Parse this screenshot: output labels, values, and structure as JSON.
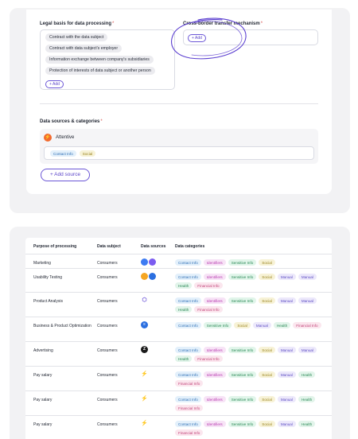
{
  "form": {
    "legal_label": "Legal basis for data processing",
    "required_mark": "*",
    "legal_items": [
      "Contract with the data subject",
      "Contract with data subject's employer",
      "Information exchange between company's subsidiaries",
      "Protection of interests of data subject or another person"
    ],
    "add_label": "+ Add",
    "cross_label": "Cross-border transfer mechanism",
    "sources_label": "Data sources & categories",
    "source": {
      "name": "Attentive",
      "icon": "attentive-logo-icon",
      "tags": [
        "Contact Info",
        "Social"
      ]
    },
    "add_source_label": "+ Add source"
  },
  "colors": {
    "accent": "#6b56d6",
    "annotation_stroke": "#5b3fd0",
    "tag_styles": {
      "Contact Info": {
        "bg": "#e3f0fb",
        "fg": "#2f6fb5"
      },
      "Identifiers": {
        "bg": "#f7e3f6",
        "fg": "#b93db0"
      },
      "Sensitive Info": {
        "bg": "#e1f5ea",
        "fg": "#2b8a57"
      },
      "Social": {
        "bg": "#f7f2d6",
        "fg": "#9a8420"
      },
      "Manual": {
        "bg": "#ece8fb",
        "fg": "#5f4fc4"
      },
      "Health": {
        "bg": "#e2f4ea",
        "fg": "#2c8a57"
      },
      "Financial Info": {
        "bg": "#fbe6ee",
        "fg": "#c2457a"
      }
    }
  },
  "table": {
    "headers": [
      "Purpose of processing",
      "Data subject",
      "Data sources",
      "Data categories"
    ],
    "rows": [
      {
        "purpose": "Marketing",
        "subject": "Consumers",
        "sources": [
          {
            "icon": "messenger-icon",
            "color": "#3d7bf2",
            "glyph": "●"
          },
          {
            "icon": "chat-bubble-icon",
            "color": "#7b5cf0",
            "glyph": "●"
          }
        ],
        "categories": [
          "Contact Info",
          "Identifiers",
          "Sensitive Info",
          "Social"
        ]
      },
      {
        "purpose": "Usability Testing",
        "subject": "Consumers",
        "sources": [
          {
            "icon": "hubspot-icon",
            "color": "#f5a623",
            "glyph": "●"
          },
          {
            "icon": "app-store-icon",
            "color": "#2b6fe0",
            "glyph": "●"
          }
        ],
        "categories": [
          "Contact Info",
          "Identifiers",
          "Sensitive Info",
          "Social",
          "Manual",
          "Manual",
          "Health",
          "Financial Info"
        ]
      },
      {
        "purpose": "Product Analysis",
        "subject": "Consumers",
        "sources": [
          {
            "icon": "hexagon-icon",
            "color": "#6a52d8",
            "glyph": "⬡"
          }
        ],
        "categories": [
          "Contact Info",
          "Identifiers",
          "Sensitive Info",
          "Social",
          "Manual",
          "Manual",
          "Health",
          "Financial Info"
        ]
      },
      {
        "purpose": "Business & Product Optimization",
        "subject": "Consumers",
        "sources": [
          {
            "icon": "intercom-icon",
            "color": "#2b6fe0",
            "glyph": "≡"
          }
        ],
        "categories": [
          "Contact Info",
          "Sensitive Info",
          "Social",
          "Manual",
          "Health",
          "Financial Info"
        ]
      },
      {
        "purpose": "Advertising",
        "subject": "Consumers",
        "sources": [
          {
            "icon": "zendesk-icon",
            "color": "#1b1b1b",
            "glyph": "Z"
          }
        ],
        "categories": [
          "Contact Info",
          "Identifiers",
          "Sensitive Info",
          "Social",
          "Manual",
          "Manual",
          "Health",
          "Financial Info"
        ]
      },
      {
        "purpose": "Pay salary",
        "subject": "Consumers",
        "sources": [
          {
            "icon": "attentive-logo-icon",
            "color": "#e64a2e",
            "glyph": "⚡"
          }
        ],
        "categories": [
          "Contact Info",
          "Identifiers",
          "Sensitive Info",
          "Social",
          "Manual",
          "Health",
          "Financial Info"
        ]
      },
      {
        "purpose": "Pay salary",
        "subject": "Consumers",
        "sources": [
          {
            "icon": "attentive-logo-icon",
            "color": "#e64a2e",
            "glyph": "⚡"
          }
        ],
        "categories": [
          "Contact Info",
          "Identifiers",
          "Sensitive Info",
          "Social",
          "Manual",
          "Health",
          "Financial Info"
        ]
      },
      {
        "purpose": "Pay salary",
        "subject": "Consumers",
        "sources": [
          {
            "icon": "attentive-logo-icon",
            "color": "#e64a2e",
            "glyph": "⚡"
          }
        ],
        "categories": [
          "Contact Info",
          "Identifiers",
          "Sensitive Info",
          "Social",
          "Manual",
          "Health",
          "Financial Info"
        ]
      }
    ]
  }
}
